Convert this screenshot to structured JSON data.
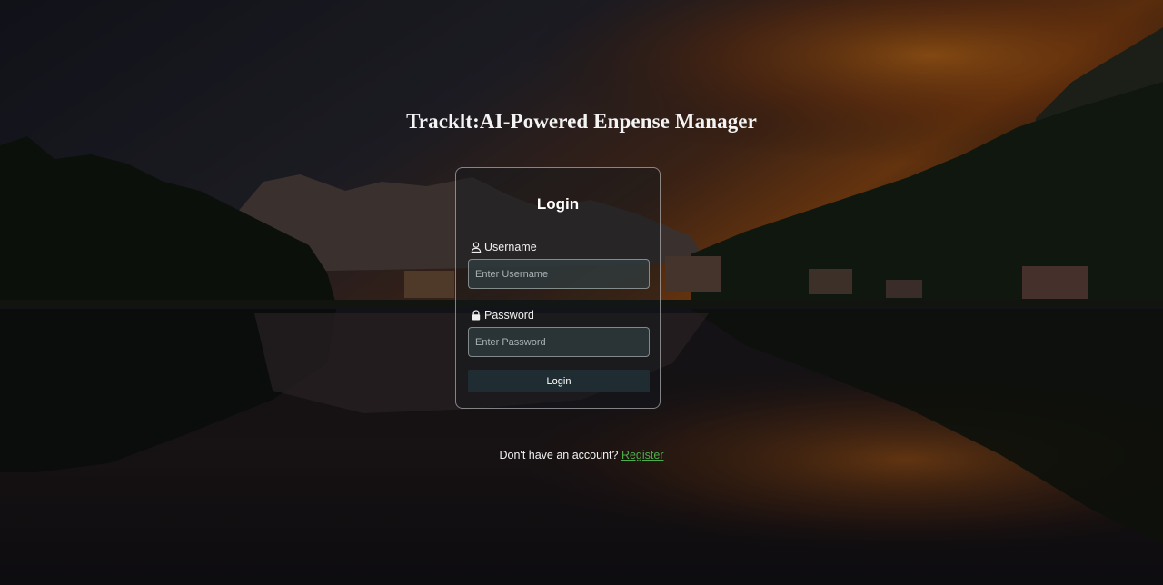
{
  "page": {
    "title": "Tracklt:AI-Powered Enpense Manager"
  },
  "login_form": {
    "heading": "Login",
    "username": {
      "label": "Username",
      "placeholder": "Enter Username",
      "value": "",
      "icon": "user-icon"
    },
    "password": {
      "label": "Password",
      "placeholder": "Enter Password",
      "value": "",
      "icon": "lock-icon"
    },
    "submit_label": "Login"
  },
  "footer": {
    "prompt": "Don't have an account?",
    "register_label": "Register"
  },
  "colors": {
    "link": "#4cae4c",
    "button": "#1f2d33"
  }
}
